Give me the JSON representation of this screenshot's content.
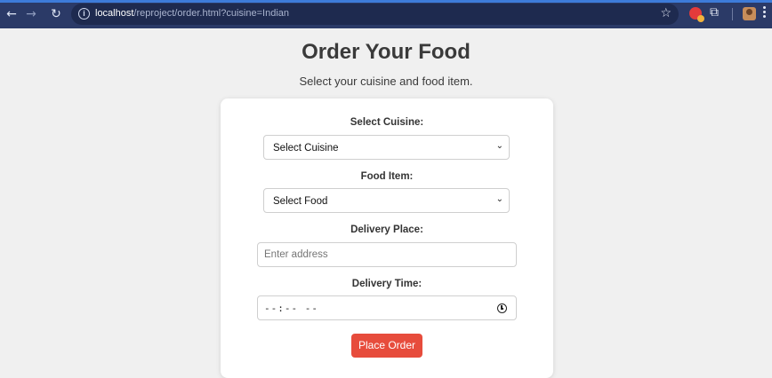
{
  "browser": {
    "url_host": "localhost",
    "url_path": "/reproject/order.html?cuisine=Indian",
    "icons": {
      "back": "back-arrow-icon",
      "forward": "forward-arrow-icon",
      "reload": "reload-icon",
      "info": "info-icon",
      "star": "star-icon",
      "extension": "extension-icon",
      "puzzle": "puzzle-icon",
      "profile": "avatar",
      "menu": "kebab-menu-icon"
    }
  },
  "page": {
    "title": "Order Your Food",
    "subtitle": "Select your cuisine and food item."
  },
  "form": {
    "cuisine_label": "Select Cuisine:",
    "cuisine_value": "Select Cuisine",
    "food_label": "Food Item:",
    "food_value": "Select Food",
    "place_label": "Delivery Place:",
    "place_placeholder": "Enter address",
    "time_label": "Delivery Time:",
    "time_value": "--:-- --",
    "submit_label": "Place Order"
  },
  "colors": {
    "chrome_bg": "#2b3a67",
    "page_bg": "#f0f0f0",
    "button_bg": "#e74c3c"
  }
}
